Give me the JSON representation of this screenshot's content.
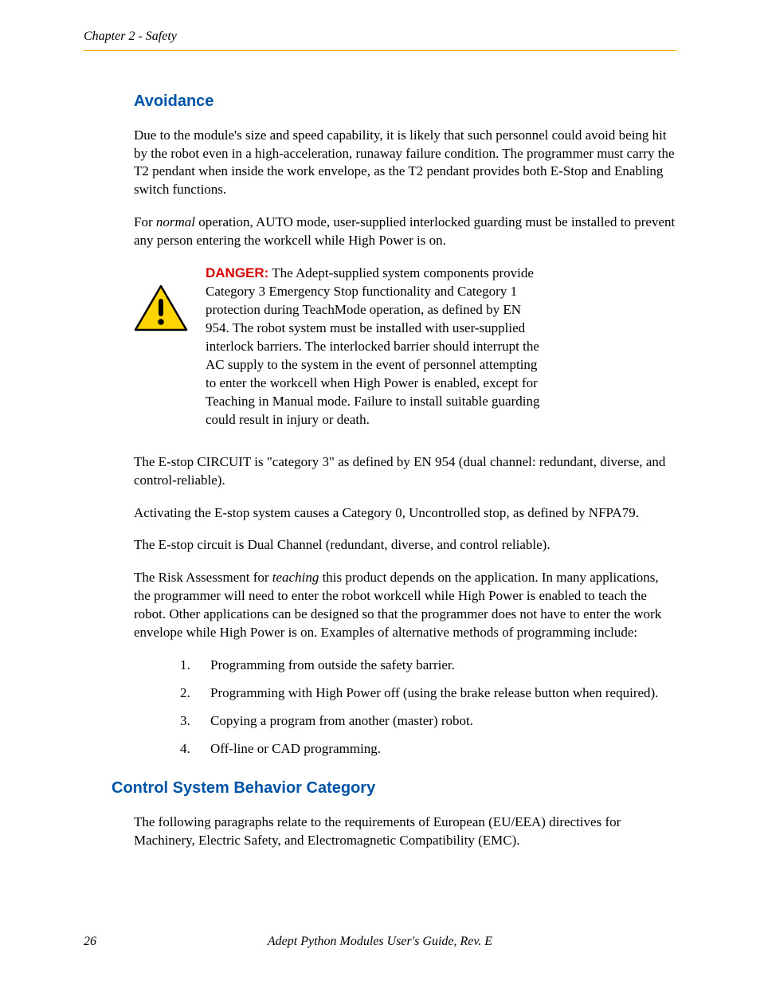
{
  "header": {
    "running": "Chapter 2 - Safety"
  },
  "sections": {
    "avoidance": {
      "title": "Avoidance",
      "p1_a": "Due to the module's size and speed capability, it is likely that such personnel could avoid being hit by the robot even in a high-acceleration, runaway failure condition. The programmer must carry the T2 pendant when inside the work envelope, as the T2 pendant provides both E-Stop and Enabling switch functions.",
      "p2_pre": "For ",
      "p2_em": "normal",
      "p2_post": " operation, AUTO mode, user-supplied interlocked guarding must be installed to prevent any person entering the workcell while High Power is on.",
      "danger_label": "DANGER:",
      "danger_text": " The Adept-supplied system components provide Category 3 Emergency Stop functionality and Category 1 protection during TeachMode operation, as defined by EN 954. The robot system must be installed with user-supplied interlock barriers. The interlocked barrier should interrupt the AC supply to the system in the event of personnel attempting to enter the workcell when High Power is enabled, except for Teaching in Manual mode. Failure to install suitable guarding could result in injury or death.",
      "p3": "The E-stop CIRCUIT is \"category 3\" as defined by EN 954 (dual channel: redundant, diverse, and control-reliable).",
      "p4": "Activating the E-stop system causes a Category 0, Uncontrolled stop, as defined by NFPA79.",
      "p5": "The E-stop circuit is Dual Channel (redundant, diverse, and control reliable).",
      "p6_pre": "The Risk Assessment for ",
      "p6_em": "teaching",
      "p6_post": " this product depends on the application. In many applications, the programmer will need to enter the robot workcell while High Power is enabled to teach the robot. Other applications can be designed so that the programmer does not have to enter the work envelope while High Power is on. Examples of alternative methods of programming include:",
      "list": [
        "Programming from outside the safety barrier.",
        "Programming with High Power off (using the brake release button when required).",
        "Copying a program from another (master) robot.",
        "Off-line or CAD programming."
      ]
    },
    "control": {
      "title": "Control System Behavior Category",
      "p1": "The following paragraphs relate to the requirements of European (EU/EEA) directives for Machinery, Electric Safety, and Electromagnetic Compatibility (EMC)."
    }
  },
  "footer": {
    "page": "26",
    "title": "Adept Python Modules User's Guide, Rev. E"
  }
}
